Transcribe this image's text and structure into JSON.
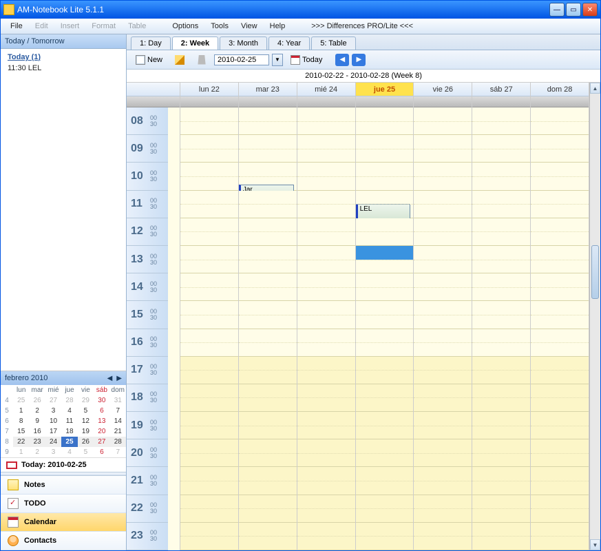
{
  "title": "AM-Notebook Lite  5.1.1",
  "menu": {
    "file": "File",
    "edit": "Edit",
    "insert": "Insert",
    "format": "Format",
    "table": "Table",
    "options": "Options",
    "tools": "Tools",
    "view": "View",
    "help": "Help",
    "diff": ">>> Differences PRO/Lite <<<"
  },
  "sidebar": {
    "header": "Today / Tomorrow",
    "today_label": "Today (1)",
    "events": [
      "11:30 LEL"
    ]
  },
  "minical": {
    "month": "febrero 2010",
    "dows": [
      "lun",
      "mar",
      "mié",
      "jue",
      "vie",
      "sáb",
      "dom"
    ],
    "weeks": [
      {
        "wk": "4",
        "days": [
          {
            "n": "25",
            "o": 1
          },
          {
            "n": "26",
            "o": 1
          },
          {
            "n": "27",
            "o": 1
          },
          {
            "n": "28",
            "o": 1
          },
          {
            "n": "29",
            "o": 1
          },
          {
            "n": "30",
            "o": 1,
            "s": 1
          },
          {
            "n": "31",
            "o": 1
          }
        ]
      },
      {
        "wk": "5",
        "days": [
          {
            "n": "1"
          },
          {
            "n": "2"
          },
          {
            "n": "3"
          },
          {
            "n": "4"
          },
          {
            "n": "5"
          },
          {
            "n": "6",
            "s": 1
          },
          {
            "n": "7"
          }
        ]
      },
      {
        "wk": "6",
        "days": [
          {
            "n": "8"
          },
          {
            "n": "9"
          },
          {
            "n": "10"
          },
          {
            "n": "11"
          },
          {
            "n": "12"
          },
          {
            "n": "13",
            "s": 1
          },
          {
            "n": "14"
          }
        ]
      },
      {
        "wk": "7",
        "days": [
          {
            "n": "15"
          },
          {
            "n": "16"
          },
          {
            "n": "17"
          },
          {
            "n": "18"
          },
          {
            "n": "19"
          },
          {
            "n": "20",
            "s": 1
          },
          {
            "n": "21"
          }
        ]
      },
      {
        "wk": "8",
        "days": [
          {
            "n": "22",
            "w": 1
          },
          {
            "n": "23",
            "w": 1
          },
          {
            "n": "24",
            "w": 1
          },
          {
            "n": "25",
            "t": 1
          },
          {
            "n": "26",
            "w": 1
          },
          {
            "n": "27",
            "w": 1,
            "s": 1
          },
          {
            "n": "28",
            "w": 1
          }
        ]
      },
      {
        "wk": "9",
        "days": [
          {
            "n": "1",
            "o": 1
          },
          {
            "n": "2",
            "o": 1
          },
          {
            "n": "3",
            "o": 1
          },
          {
            "n": "4",
            "o": 1
          },
          {
            "n": "5",
            "o": 1
          },
          {
            "n": "6",
            "o": 1,
            "s": 1
          },
          {
            "n": "7",
            "o": 1
          }
        ]
      }
    ],
    "today_line": "Today: 2010-02-25"
  },
  "nav": {
    "notes": "Notes",
    "todo": "TODO",
    "calendar": "Calendar",
    "contacts": "Contacts"
  },
  "viewtabs": {
    "day": "1: Day",
    "week": "2: Week",
    "month": "3: Month",
    "year": "4: Year",
    "table": "5: Table"
  },
  "toolbar": {
    "new": "New",
    "date": "2010-02-25",
    "today": "Today"
  },
  "range": "2010-02-22  -  2010-02-28   (Week 8)",
  "dayheads": [
    "lun 22",
    "mar 23",
    "mié 24",
    "jue 25",
    "vie 26",
    "sáb 27",
    "dom 28"
  ],
  "hours": [
    "08",
    "09",
    "10",
    "11",
    "12",
    "13",
    "14",
    "15",
    "16",
    "17",
    "18",
    "19",
    "20",
    "21",
    "22",
    "23"
  ],
  "mins": {
    "m00": "00",
    "m30": "30"
  },
  "events": {
    "jar": "Jar",
    "lel": "LEL"
  }
}
